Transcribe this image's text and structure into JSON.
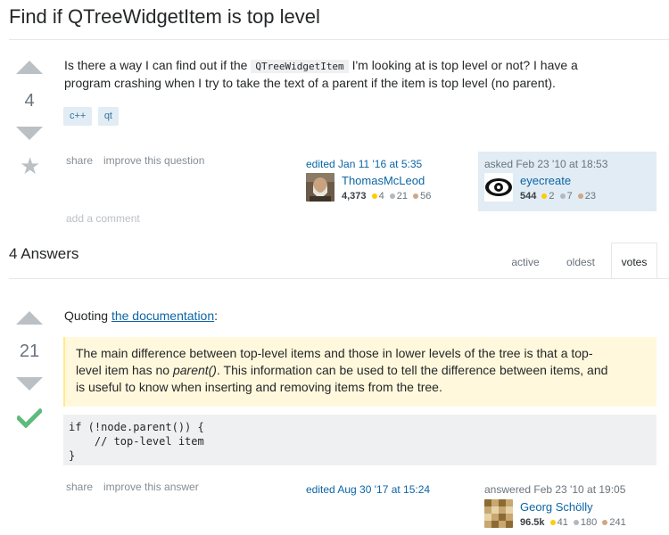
{
  "question": {
    "title": "Find if QTreeWidgetItem is top level",
    "vote_count": "4",
    "body_before_code": "Is there a way I can find out if the ",
    "inline_code": "QTreeWidgetItem",
    "body_line1_after_code": " I'm looking at is top level or not? I have a",
    "body_line2": "program crashing when I try to take the text of a parent if the item is top level (no parent).",
    "tags": [
      "c++",
      "qt"
    ],
    "menu": {
      "share": "share",
      "improve": "improve this question"
    },
    "add_comment": "add a comment",
    "editor": {
      "action": "edited Jan 11 '16 at 5:35",
      "name": "ThomasMcLeod",
      "reputation": "4,373",
      "gold": "4",
      "silver": "21",
      "bronze": "56"
    },
    "asker": {
      "action": "asked Feb 23 '10 at 18:53",
      "name": "eyecreate",
      "reputation": "544",
      "gold": "2",
      "silver": "7",
      "bronze": "23"
    }
  },
  "answers_header": "4 Answers",
  "sort_tabs": [
    "active",
    "oldest",
    "votes"
  ],
  "answer": {
    "vote_count": "21",
    "intro_prefix": "Quoting ",
    "intro_link": "the documentation",
    "intro_suffix": ":",
    "quote_part1": "The main difference between top-level items and those in lower levels of the tree is that a top-",
    "quote_part2_prefix": "level item has no ",
    "quote_emphasis": "parent()",
    "quote_part2_suffix": ". This information can be used to tell the difference between items, and",
    "quote_part3": "is useful to know when inserting and removing items from the tree.",
    "code_lines": [
      "if (!node.parent()) {",
      "    // top-level item",
      "}"
    ],
    "menu": {
      "share": "share",
      "improve": "improve this answer"
    },
    "editor_action": "edited Aug 30 '17 at 15:24",
    "answerer": {
      "action": "answered Feb 23 '10 at 19:05",
      "name": "Georg Schölly",
      "reputation": "96.5k",
      "gold": "41",
      "silver": "180",
      "bronze": "241"
    }
  },
  "colors": {
    "accepted": "#5eba7d",
    "vote_arrow": "#bbc0c4",
    "link": "#0c65a5",
    "tag_bg": "#e1ecf4",
    "tag_text": "#39739d",
    "quote_bg": "#fff8dc",
    "asker_bg": "#e1ecf4"
  },
  "icons": {
    "upvote": "upvote-arrow-icon",
    "downvote": "downvote-arrow-icon",
    "favorite": "star-icon",
    "accepted": "checkmark-icon"
  }
}
